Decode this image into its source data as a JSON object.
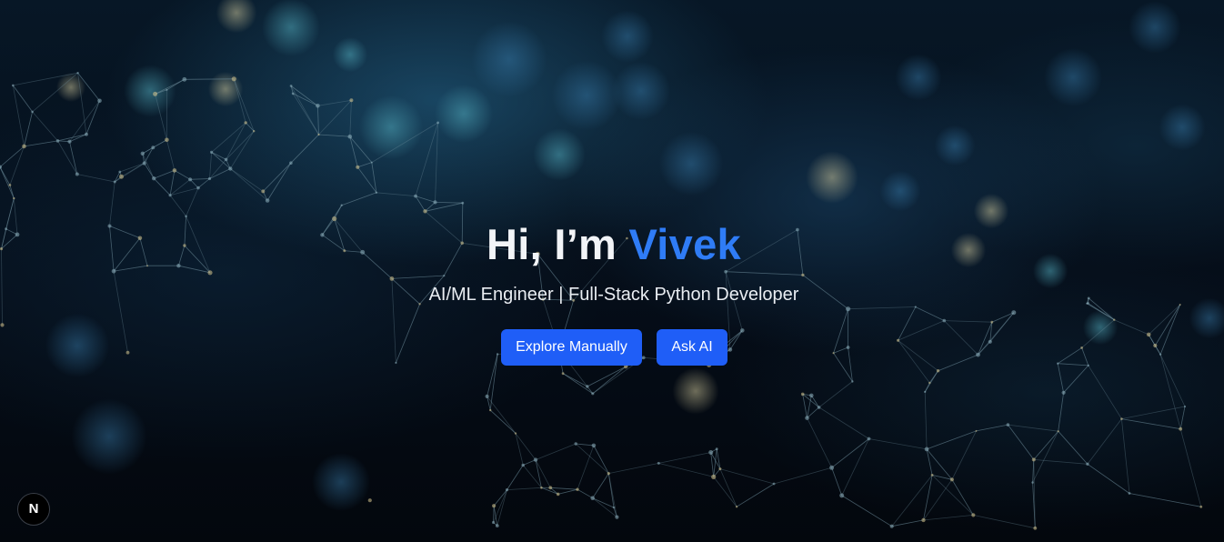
{
  "hero": {
    "greeting": "Hi, I’m ",
    "name": "Vivek",
    "subtitle": "AI/ML Engineer | Full-Stack Python Developer",
    "buttons": {
      "explore_label": "Explore Manually",
      "ask_label": "Ask AI"
    }
  },
  "dev_indicator": {
    "label": "N",
    "icon": "next-logo-icon"
  },
  "colors": {
    "accent": "#2f7cf6",
    "button": "#1f5ef7",
    "heading": "#f2f4f7",
    "background": "#05080f"
  }
}
